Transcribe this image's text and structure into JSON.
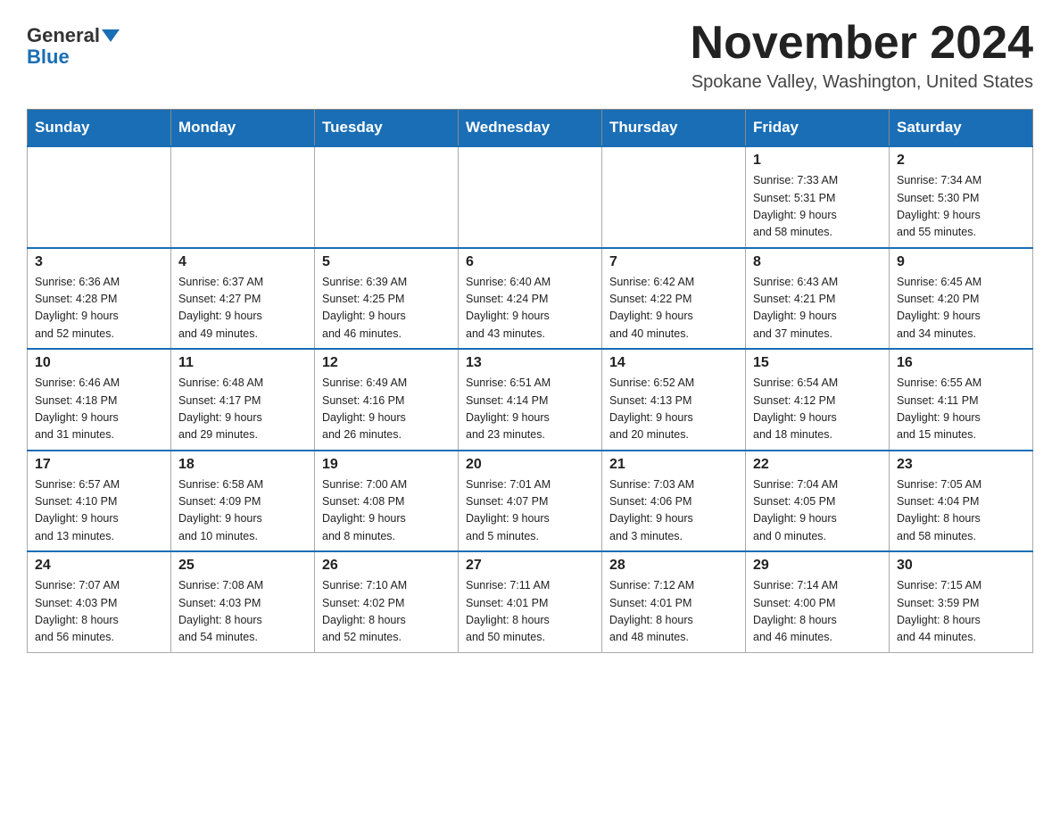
{
  "header": {
    "logo_line1": "General",
    "logo_line2": "Blue",
    "title": "November 2024",
    "subtitle": "Spokane Valley, Washington, United States"
  },
  "days_of_week": [
    "Sunday",
    "Monday",
    "Tuesday",
    "Wednesday",
    "Thursday",
    "Friday",
    "Saturday"
  ],
  "weeks": [
    [
      {
        "day": "",
        "info": ""
      },
      {
        "day": "",
        "info": ""
      },
      {
        "day": "",
        "info": ""
      },
      {
        "day": "",
        "info": ""
      },
      {
        "day": "",
        "info": ""
      },
      {
        "day": "1",
        "info": "Sunrise: 7:33 AM\nSunset: 5:31 PM\nDaylight: 9 hours\nand 58 minutes."
      },
      {
        "day": "2",
        "info": "Sunrise: 7:34 AM\nSunset: 5:30 PM\nDaylight: 9 hours\nand 55 minutes."
      }
    ],
    [
      {
        "day": "3",
        "info": "Sunrise: 6:36 AM\nSunset: 4:28 PM\nDaylight: 9 hours\nand 52 minutes."
      },
      {
        "day": "4",
        "info": "Sunrise: 6:37 AM\nSunset: 4:27 PM\nDaylight: 9 hours\nand 49 minutes."
      },
      {
        "day": "5",
        "info": "Sunrise: 6:39 AM\nSunset: 4:25 PM\nDaylight: 9 hours\nand 46 minutes."
      },
      {
        "day": "6",
        "info": "Sunrise: 6:40 AM\nSunset: 4:24 PM\nDaylight: 9 hours\nand 43 minutes."
      },
      {
        "day": "7",
        "info": "Sunrise: 6:42 AM\nSunset: 4:22 PM\nDaylight: 9 hours\nand 40 minutes."
      },
      {
        "day": "8",
        "info": "Sunrise: 6:43 AM\nSunset: 4:21 PM\nDaylight: 9 hours\nand 37 minutes."
      },
      {
        "day": "9",
        "info": "Sunrise: 6:45 AM\nSunset: 4:20 PM\nDaylight: 9 hours\nand 34 minutes."
      }
    ],
    [
      {
        "day": "10",
        "info": "Sunrise: 6:46 AM\nSunset: 4:18 PM\nDaylight: 9 hours\nand 31 minutes."
      },
      {
        "day": "11",
        "info": "Sunrise: 6:48 AM\nSunset: 4:17 PM\nDaylight: 9 hours\nand 29 minutes."
      },
      {
        "day": "12",
        "info": "Sunrise: 6:49 AM\nSunset: 4:16 PM\nDaylight: 9 hours\nand 26 minutes."
      },
      {
        "day": "13",
        "info": "Sunrise: 6:51 AM\nSunset: 4:14 PM\nDaylight: 9 hours\nand 23 minutes."
      },
      {
        "day": "14",
        "info": "Sunrise: 6:52 AM\nSunset: 4:13 PM\nDaylight: 9 hours\nand 20 minutes."
      },
      {
        "day": "15",
        "info": "Sunrise: 6:54 AM\nSunset: 4:12 PM\nDaylight: 9 hours\nand 18 minutes."
      },
      {
        "day": "16",
        "info": "Sunrise: 6:55 AM\nSunset: 4:11 PM\nDaylight: 9 hours\nand 15 minutes."
      }
    ],
    [
      {
        "day": "17",
        "info": "Sunrise: 6:57 AM\nSunset: 4:10 PM\nDaylight: 9 hours\nand 13 minutes."
      },
      {
        "day": "18",
        "info": "Sunrise: 6:58 AM\nSunset: 4:09 PM\nDaylight: 9 hours\nand 10 minutes."
      },
      {
        "day": "19",
        "info": "Sunrise: 7:00 AM\nSunset: 4:08 PM\nDaylight: 9 hours\nand 8 minutes."
      },
      {
        "day": "20",
        "info": "Sunrise: 7:01 AM\nSunset: 4:07 PM\nDaylight: 9 hours\nand 5 minutes."
      },
      {
        "day": "21",
        "info": "Sunrise: 7:03 AM\nSunset: 4:06 PM\nDaylight: 9 hours\nand 3 minutes."
      },
      {
        "day": "22",
        "info": "Sunrise: 7:04 AM\nSunset: 4:05 PM\nDaylight: 9 hours\nand 0 minutes."
      },
      {
        "day": "23",
        "info": "Sunrise: 7:05 AM\nSunset: 4:04 PM\nDaylight: 8 hours\nand 58 minutes."
      }
    ],
    [
      {
        "day": "24",
        "info": "Sunrise: 7:07 AM\nSunset: 4:03 PM\nDaylight: 8 hours\nand 56 minutes."
      },
      {
        "day": "25",
        "info": "Sunrise: 7:08 AM\nSunset: 4:03 PM\nDaylight: 8 hours\nand 54 minutes."
      },
      {
        "day": "26",
        "info": "Sunrise: 7:10 AM\nSunset: 4:02 PM\nDaylight: 8 hours\nand 52 minutes."
      },
      {
        "day": "27",
        "info": "Sunrise: 7:11 AM\nSunset: 4:01 PM\nDaylight: 8 hours\nand 50 minutes."
      },
      {
        "day": "28",
        "info": "Sunrise: 7:12 AM\nSunset: 4:01 PM\nDaylight: 8 hours\nand 48 minutes."
      },
      {
        "day": "29",
        "info": "Sunrise: 7:14 AM\nSunset: 4:00 PM\nDaylight: 8 hours\nand 46 minutes."
      },
      {
        "day": "30",
        "info": "Sunrise: 7:15 AM\nSunset: 3:59 PM\nDaylight: 8 hours\nand 44 minutes."
      }
    ]
  ]
}
